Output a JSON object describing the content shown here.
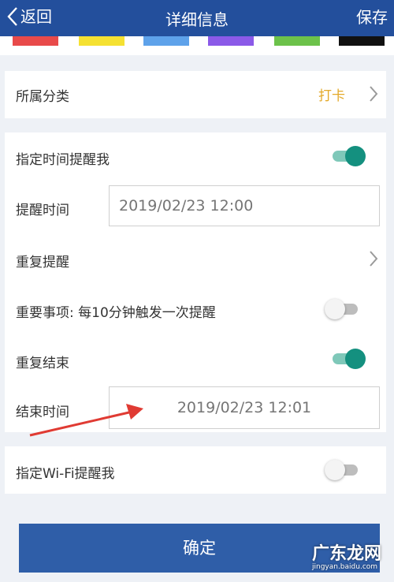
{
  "header": {
    "back_label": "返回",
    "title": "详细信息",
    "save_label": "保存"
  },
  "color_swatches": [
    "#e84a4a",
    "#f5e132",
    "#5ea2ea",
    "#8b5ae8",
    "#6cc24a",
    "#111111"
  ],
  "category": {
    "label": "所属分类",
    "value": "打卡"
  },
  "reminders": {
    "specify_time_label": "指定时间提醒我",
    "specify_time_enabled": true,
    "remind_time_label": "提醒时间",
    "remind_time_value": "2019/02/23 12:00",
    "repeat_label": "重复提醒",
    "important_label": "重要事项: 每10分钟触发一次提醒",
    "important_enabled": false,
    "repeat_end_label": "重复结束",
    "repeat_end_enabled": true,
    "end_time_label": "结束时间",
    "end_time_value": "2019/02/23 12:01"
  },
  "wifi": {
    "label": "指定Wi-Fi提醒我",
    "enabled": false
  },
  "confirm_label": "确定",
  "watermark": {
    "main": "广东龙网",
    "sub": "jingyan.baidu.com"
  }
}
